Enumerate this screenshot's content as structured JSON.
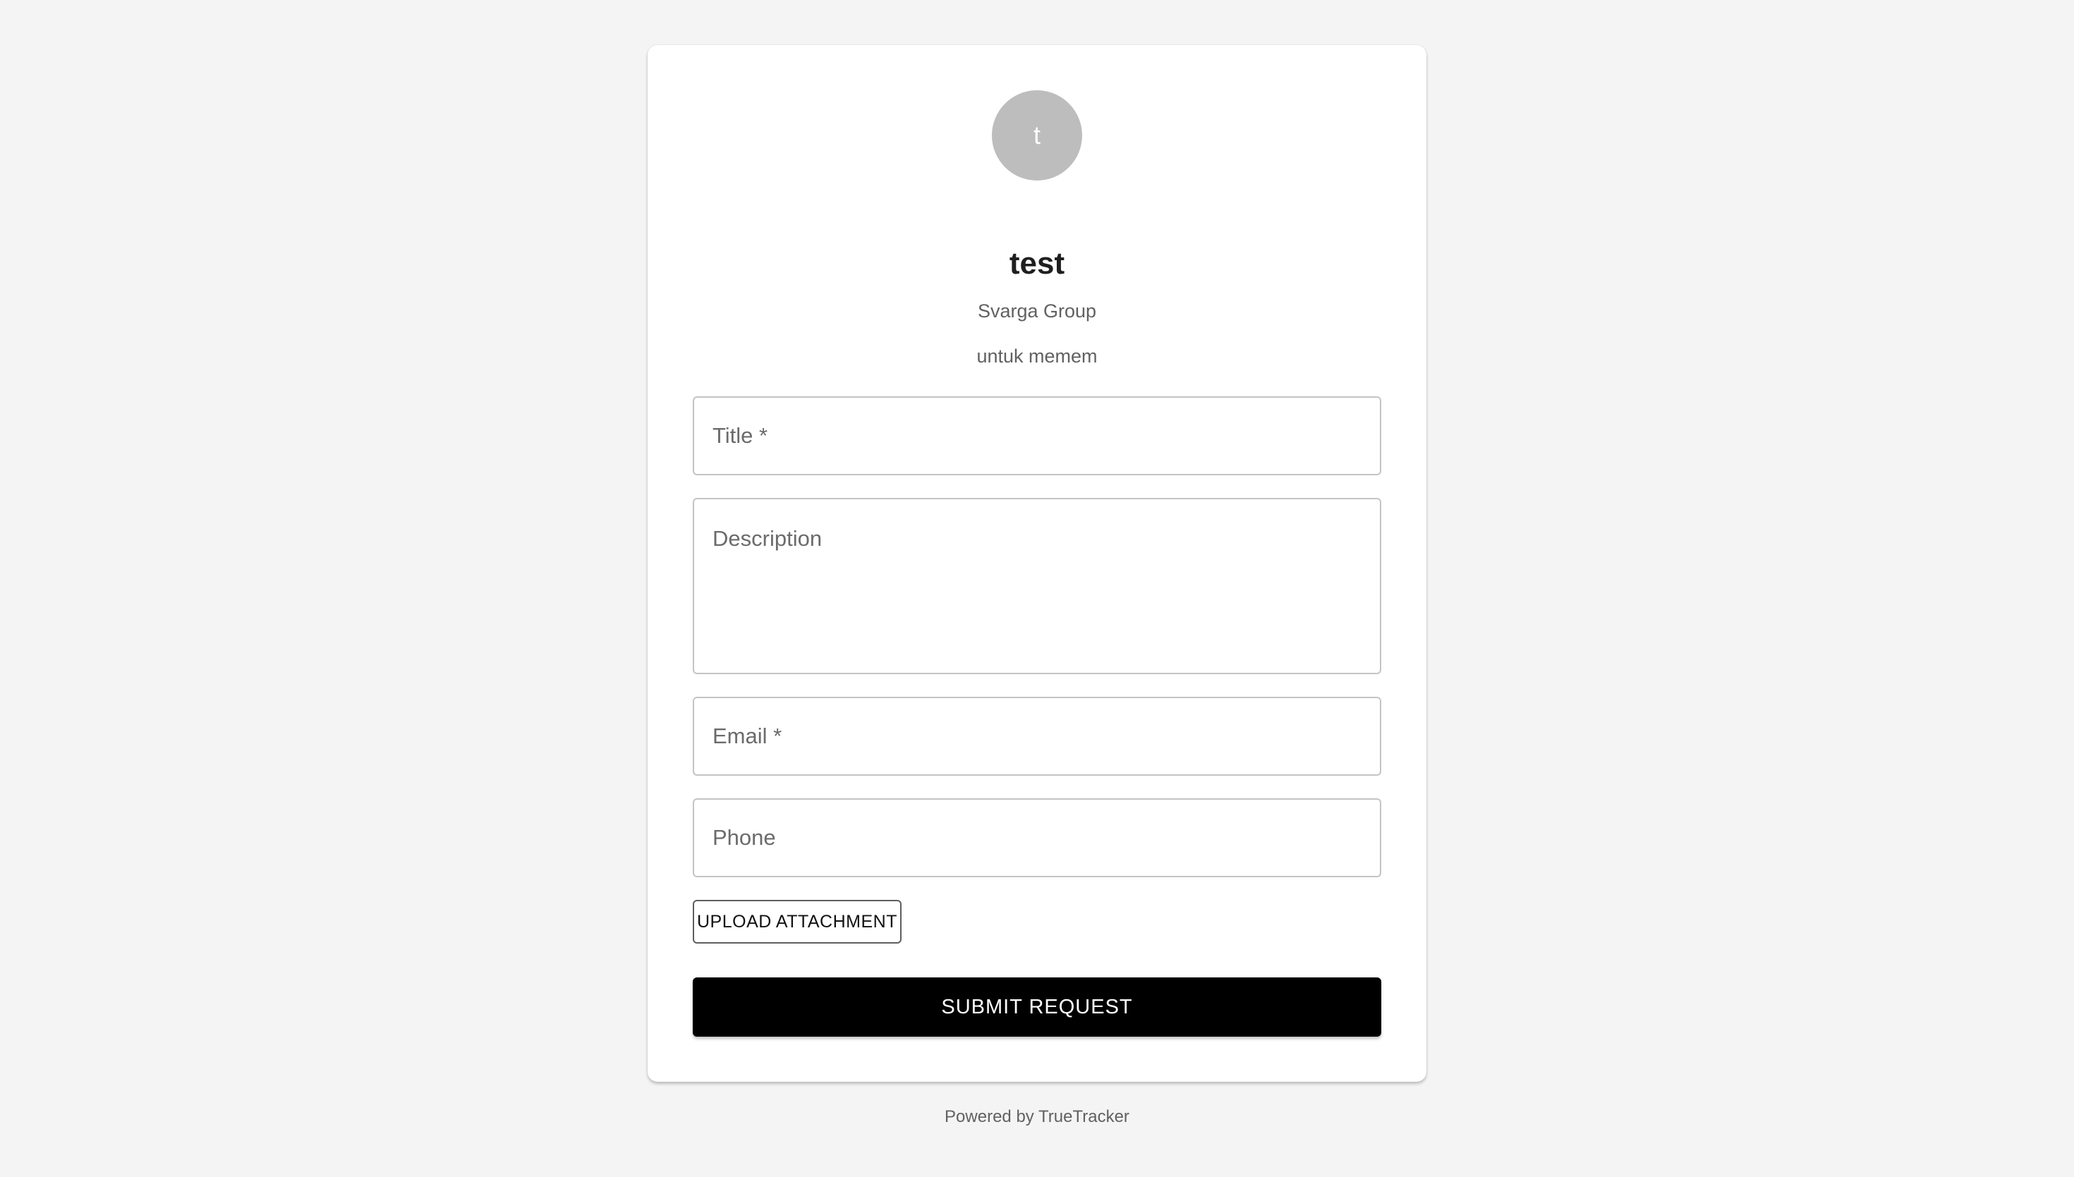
{
  "profile": {
    "avatar_initial": "t",
    "name": "test",
    "organization": "Svarga Group",
    "description": "untuk memem"
  },
  "form": {
    "title_label": "Title *",
    "description_label": "Description",
    "email_label": "Email *",
    "phone_label": "Phone",
    "upload_label": "UPLOAD ATTACHMENT",
    "submit_label": "SUBMIT REQUEST"
  },
  "footer": {
    "text": "Powered by TrueTracker"
  },
  "colors": {
    "background": "#f4f4f4",
    "card": "#ffffff",
    "avatar": "#bdbdbd",
    "primary_button": "#000000"
  }
}
